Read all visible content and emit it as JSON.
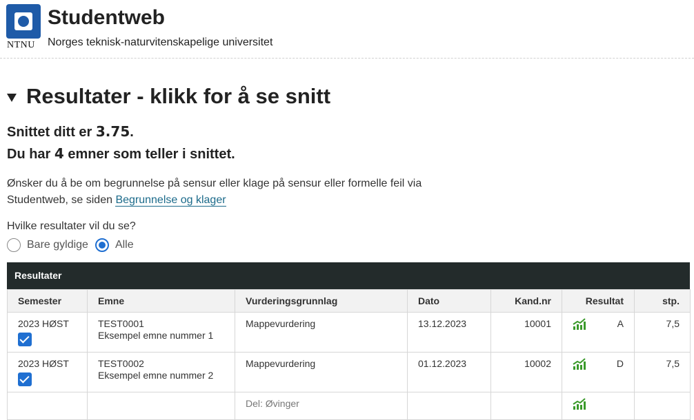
{
  "header": {
    "logo_text": "NTNU",
    "app_title": "Studentweb",
    "subtitle": "Norges teknisk-naturvitenskapelige universitet"
  },
  "section": {
    "title": "Resultater - klikk for å se snitt"
  },
  "average": {
    "prefix": "Snittet ditt er ",
    "value": "3.75",
    "suffix": ".",
    "count_prefix": "Du har ",
    "count": "4",
    "count_suffix": " emner som teller i snittet."
  },
  "info": {
    "text_line1": "Ønsker du å be om begrunnelse på sensur eller klage på sensur eller formelle feil via",
    "text_line2": "Studentweb, se siden ",
    "link": "Begrunnelse og klager"
  },
  "filter": {
    "question": "Hvilke resultater vil du se?",
    "options": [
      "Bare gyldige",
      "Alle"
    ],
    "selected": "Alle"
  },
  "table": {
    "title": "Resultater",
    "headers": [
      "Semester",
      "Emne",
      "Vurderingsgrunnlag",
      "Dato",
      "Kand.nr",
      "Resultat",
      "stp."
    ],
    "rows": [
      {
        "semester": "2023 HØST",
        "code": "TEST0001",
        "name": "Eksempel emne nummer 1",
        "basis": "Mappevurdering",
        "date": "13.12.2023",
        "cand": "10001",
        "grade": "A",
        "credits": "7,5"
      },
      {
        "semester": "2023 HØST",
        "code": "TEST0002",
        "name": "Eksempel emne nummer 2",
        "basis": "Mappevurdering",
        "date": "01.12.2023",
        "cand": "10002",
        "grade": "D",
        "credits": "7,5"
      }
    ],
    "subrow": {
      "basis": "Del: Øvinger"
    }
  },
  "colors": {
    "brand": "#1f5ba8",
    "accent": "#1f6fd1",
    "table_header": "#232b2b",
    "chart_icon": "#3a9a2a"
  }
}
